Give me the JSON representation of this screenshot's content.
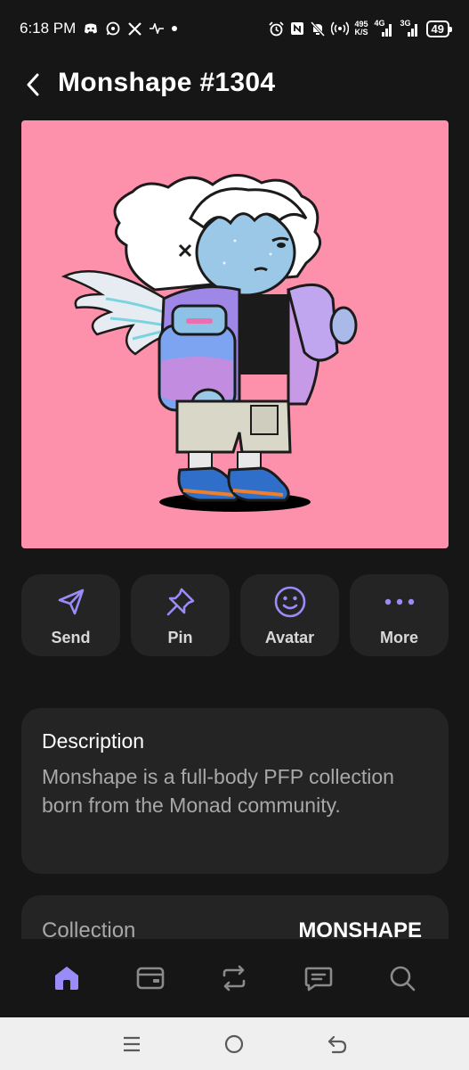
{
  "status_bar": {
    "time": "6:18 PM",
    "net_speed_value": "495",
    "net_speed_unit": "K/S",
    "net_4g": "4G",
    "net_3g": "3G",
    "battery": "49",
    "icons": [
      "discord-icon",
      "whatsapp-icon",
      "x-icon",
      "activity-icon",
      "dot-icon",
      "alarm-icon",
      "nfc-icon",
      "mute-icon",
      "hotspot-icon",
      "signal-icon",
      "battery-icon"
    ]
  },
  "header": {
    "title": "Monshape #1304",
    "back_icon": "chevron-left-icon"
  },
  "nft": {
    "background_color": "#fd91ac"
  },
  "actions": [
    {
      "label": "Send",
      "icon": "send-icon"
    },
    {
      "label": "Pin",
      "icon": "pin-icon"
    },
    {
      "label": "Avatar",
      "icon": "smiley-icon"
    },
    {
      "label": "More",
      "icon": "more-icon"
    }
  ],
  "description": {
    "title": "Description",
    "text": "Monshape is a full-body PFP collection born from the Monad community."
  },
  "collection": {
    "label": "Collection",
    "value": "MONSHAPE"
  },
  "bottom_nav": [
    {
      "name": "home",
      "icon": "home-icon",
      "active": true
    },
    {
      "name": "wallet",
      "icon": "wallet-icon",
      "active": false
    },
    {
      "name": "swap",
      "icon": "swap-icon",
      "active": false
    },
    {
      "name": "messages",
      "icon": "chat-icon",
      "active": false
    },
    {
      "name": "search",
      "icon": "search-icon",
      "active": false
    }
  ],
  "system_nav": [
    "menu-icon",
    "home-circle-icon",
    "back-icon"
  ],
  "colors": {
    "accent": "#9a8cf7",
    "background": "#161616",
    "card": "#242424",
    "nav_inactive": "#8a8a8a"
  }
}
